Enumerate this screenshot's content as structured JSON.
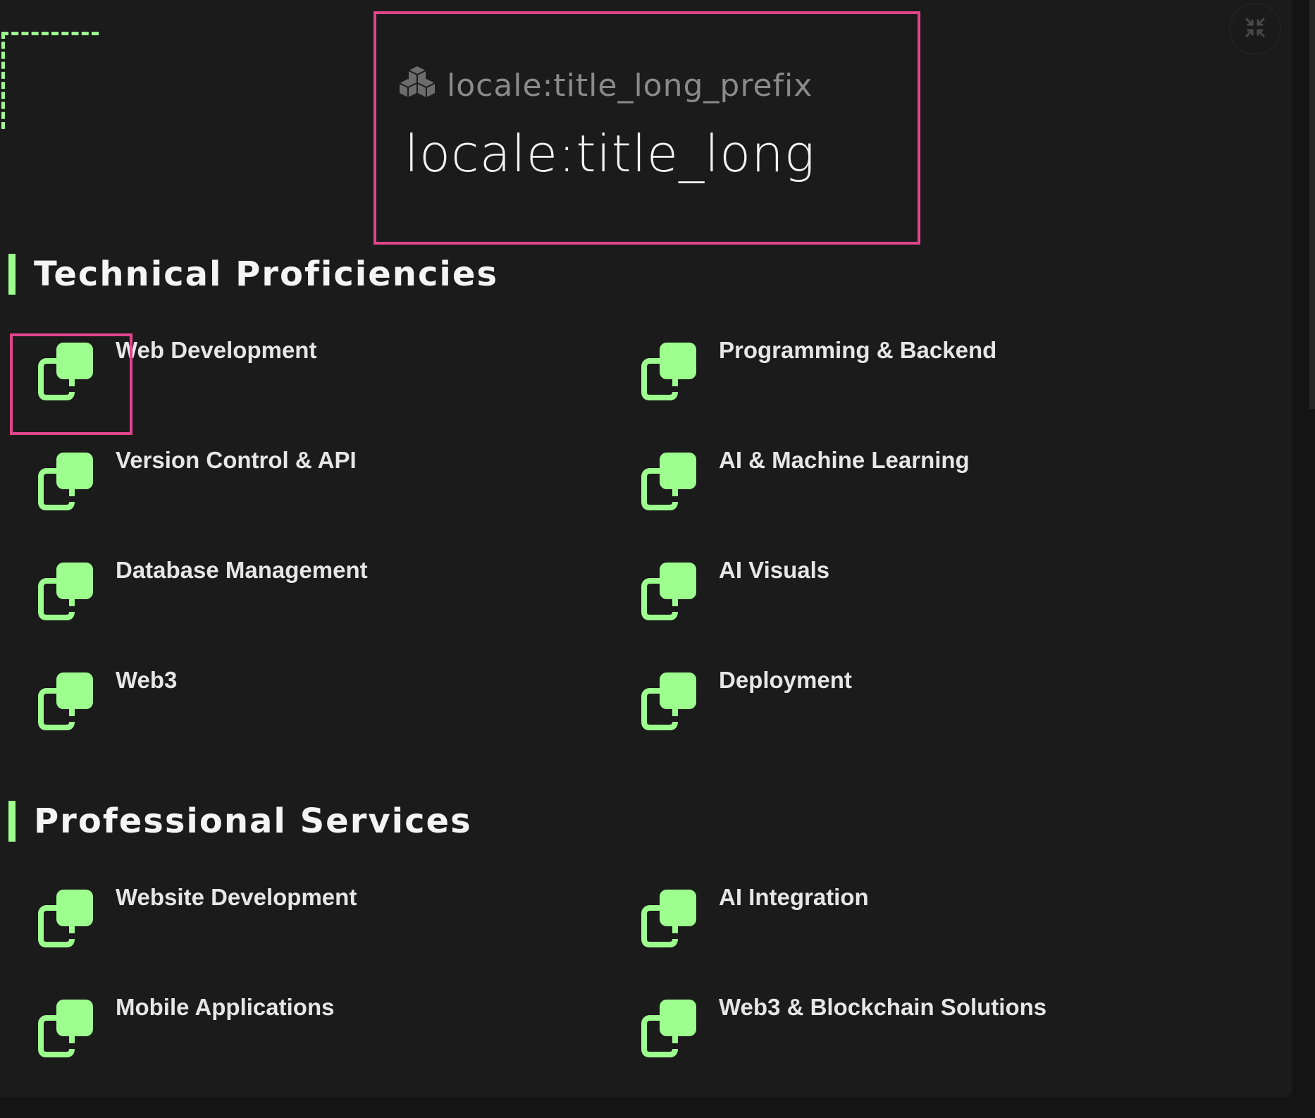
{
  "header": {
    "title_prefix": "locale:title_long_prefix",
    "title": "locale:title_long",
    "prefix_icon": "cubes-icon",
    "collapse_icon": "compress-icon"
  },
  "sections": {
    "technical": {
      "title": "Technical Proficiencies",
      "items": [
        "Web Development",
        "Programming & Backend",
        "Version Control & API",
        "AI & Machine Learning",
        "Database Management",
        "AI Visuals",
        "Web3",
        "Deployment"
      ]
    },
    "services": {
      "title": "Professional Services",
      "items": [
        "Website Development",
        "AI Integration",
        "Mobile Applications",
        "Web3 & Blockchain Solutions"
      ]
    }
  },
  "item_icon": "copy-icon",
  "colors": {
    "accent": "#9dff8e",
    "highlight": "#e0458c",
    "background": "#1b1b1b"
  }
}
